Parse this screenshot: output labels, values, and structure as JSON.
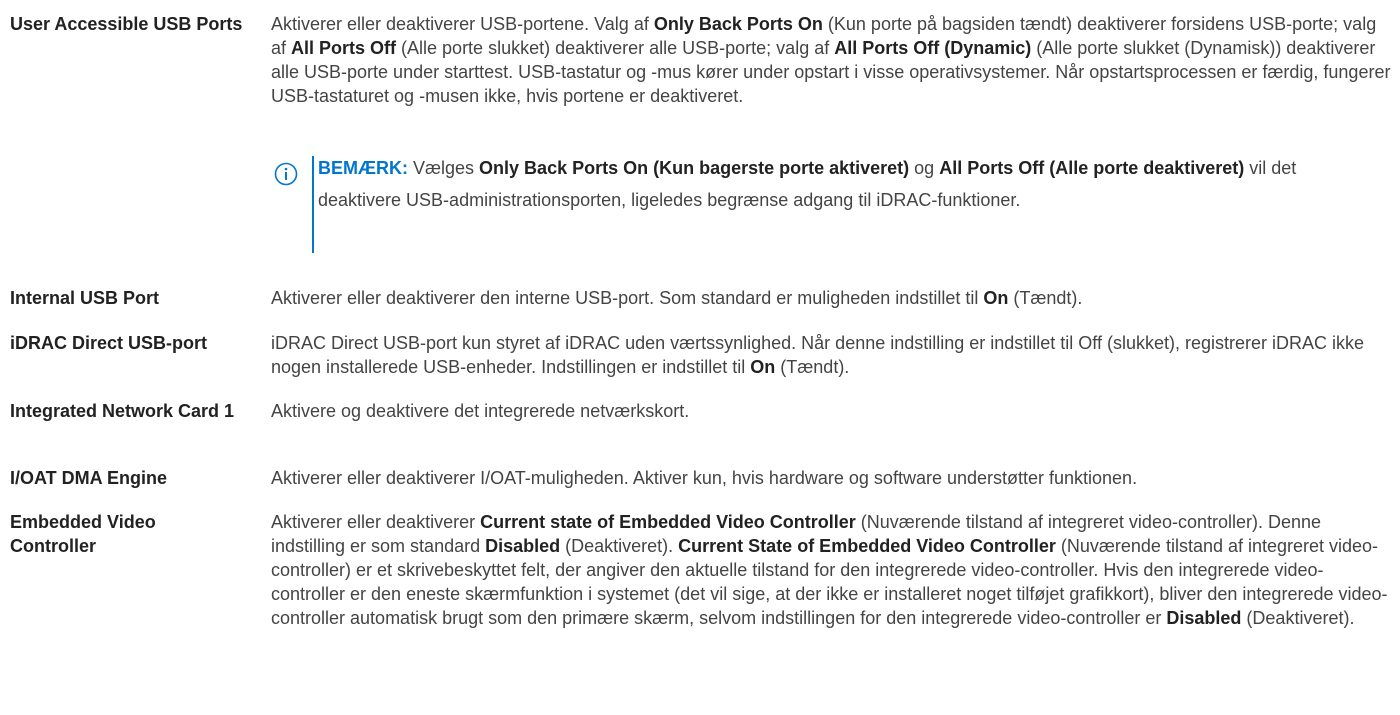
{
  "rows": [
    {
      "term": "User Accessible USB Ports",
      "desc": [
        {
          "t": "Aktiverer eller deaktiverer USB-portene. Valg af ",
          "b": false
        },
        {
          "t": "Only Back Ports On",
          "b": true
        },
        {
          "t": " (Kun porte på bagsiden tændt) deaktiverer forsidens USB-porte; valg af ",
          "b": false
        },
        {
          "t": "All Ports Off",
          "b": true
        },
        {
          "t": " (Alle porte slukket) deaktiverer alle USB-porte; valg af ",
          "b": false
        },
        {
          "t": "All Ports Off (Dynamic)",
          "b": true
        },
        {
          "t": " (Alle porte slukket (Dynamisk)) deaktiverer alle USB-porte under starttest. USB-tastatur og -mus kører under opstart i visse operativsystemer. Når opstartsprocessen er færdig, fungerer USB-tastaturet og -musen ikke, hvis portene er deaktiveret.",
          "b": false
        }
      ],
      "note": {
        "label": "BEMÆRK:",
        "segments": [
          {
            "t": " Vælges ",
            "b": false
          },
          {
            "t": "Only Back Ports On (Kun bagerste porte aktiveret)",
            "b": true
          },
          {
            "t": " og ",
            "b": false
          },
          {
            "t": "All Ports Off (Alle porte deaktiveret)",
            "b": true
          },
          {
            "t": " vil det deaktivere USB-administrationsporten, ligeledes begrænse adgang til iDRAC-funktioner.",
            "b": false
          }
        ]
      }
    },
    {
      "term": "Internal USB Port",
      "desc": [
        {
          "t": "Aktiverer eller deaktiverer den interne USB-port. Som standard er muligheden indstillet til ",
          "b": false
        },
        {
          "t": "On",
          "b": true
        },
        {
          "t": " (Tændt).",
          "b": false
        }
      ]
    },
    {
      "term": "iDRAC Direct USB-port",
      "desc": [
        {
          "t": "iDRAC Direct USB-port kun styret af iDRAC uden værtssynlighed. Når denne indstilling er indstillet til Off (slukket), registrerer iDRAC ikke nogen installerede USB-enheder. Indstillingen er indstillet til ",
          "b": false
        },
        {
          "t": "On",
          "b": true
        },
        {
          "t": " (Tændt).",
          "b": false
        }
      ]
    },
    {
      "term": "Integrated Network Card 1",
      "desc": [
        {
          "t": "Aktivere og deaktivere det integrerede netværkskort.",
          "b": false
        }
      ]
    },
    {
      "term": "I/OAT DMA Engine",
      "desc": [
        {
          "t": "Aktiverer eller deaktiverer I/OAT-muligheden. Aktiver kun, hvis hardware og software understøtter funktionen.",
          "b": false
        }
      ]
    },
    {
      "term": "Embedded Video Controller",
      "desc": [
        {
          "t": "Aktiverer eller deaktiverer ",
          "b": false
        },
        {
          "t": "Current state of Embedded Video Controller",
          "b": true
        },
        {
          "t": " (Nuværende tilstand af integreret video-controller). Denne indstilling er som standard ",
          "b": false
        },
        {
          "t": "Disabled",
          "b": true
        },
        {
          "t": " (Deaktiveret). ",
          "b": false
        },
        {
          "t": "Current State of Embedded Video Controller",
          "b": true
        },
        {
          "t": " (Nuværende tilstand af integreret video-controller) er et skrivebeskyttet felt, der angiver den aktuelle tilstand for den integrerede video-controller. Hvis den integrerede video-controller er den eneste skærmfunktion i systemet (det vil sige, at der ikke er installeret noget tilføjet grafikkort), bliver den integrerede video-controller automatisk brugt som den primære skærm, selvom indstillingen for den integrerede video-controller er ",
          "b": false
        },
        {
          "t": "Disabled",
          "b": true
        },
        {
          "t": " (Deaktiveret).",
          "b": false
        }
      ]
    }
  ]
}
